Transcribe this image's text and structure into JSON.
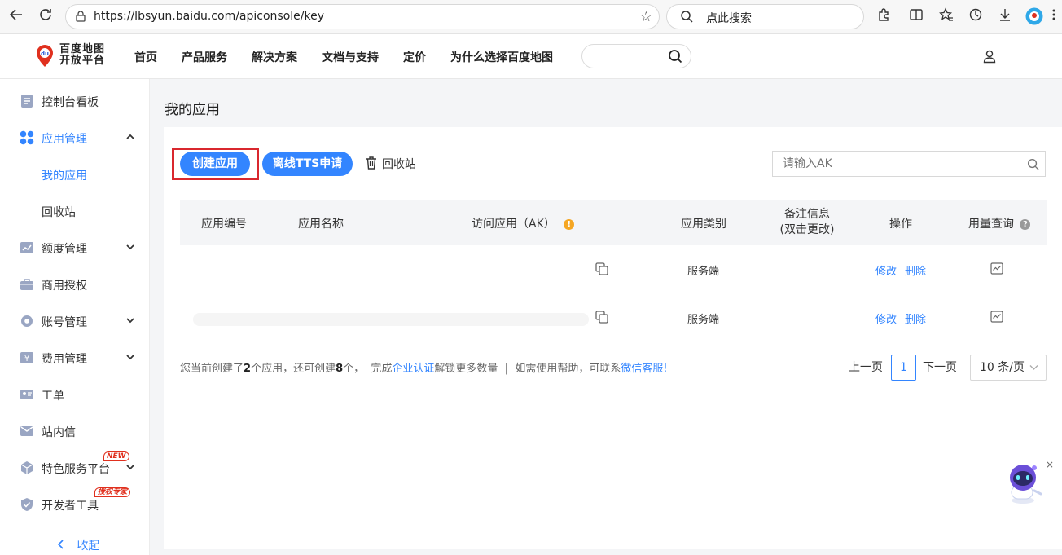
{
  "browser": {
    "url": "https://lbsyun.baidu.com/apiconsole/key",
    "search_placeholder": "点此搜索"
  },
  "header": {
    "logo_line1": "百度地图",
    "logo_line2": "开放平台",
    "nav": [
      "首页",
      "产品服务",
      "解决方案",
      "文档与支持",
      "定价",
      "为什么选择百度地图"
    ]
  },
  "sidebar": {
    "items": [
      {
        "label": "控制台看板"
      },
      {
        "label": "应用管理"
      },
      {
        "label": "我的应用"
      },
      {
        "label": "回收站"
      },
      {
        "label": "额度管理"
      },
      {
        "label": "商用授权"
      },
      {
        "label": "账号管理"
      },
      {
        "label": "费用管理"
      },
      {
        "label": "工单"
      },
      {
        "label": "站内信"
      },
      {
        "label": "特色服务平台"
      },
      {
        "label": "开发者工具"
      }
    ],
    "badge_new": "NEW",
    "badge_auth": "授权专家",
    "collapse": "收起"
  },
  "main": {
    "title": "我的应用",
    "create_btn": "创建应用",
    "tts_btn": "离线TTS申请",
    "recycle": "回收站",
    "ak_placeholder": "请输入AK"
  },
  "table": {
    "headers": {
      "id": "应用编号",
      "name": "应用名称",
      "ak": "访问应用（AK）",
      "type": "应用类别",
      "note_line1": "备注信息",
      "note_line2": "(双击更改)",
      "action": "操作",
      "usage": "用量查询"
    },
    "rows": [
      {
        "type": "服务端",
        "edit": "修改",
        "delete": "删除"
      },
      {
        "type": "服务端",
        "edit": "修改",
        "delete": "删除"
      }
    ]
  },
  "footer": {
    "p1": "您当前创建了",
    "created": "2",
    "p2": "个应用，还可创建",
    "remaining": "8",
    "p3": "个，  完成",
    "cert_link": "企业认证",
    "p4": "解锁更多数量  |  如需使用帮助，可联系",
    "wechat_link": "微信客服",
    "p5": "!"
  },
  "pager": {
    "prev": "上一页",
    "page": "1",
    "next": "下一页",
    "size": "10 条/页"
  },
  "colors": {
    "accent": "#3385ff",
    "highlight": "#d9272e"
  }
}
